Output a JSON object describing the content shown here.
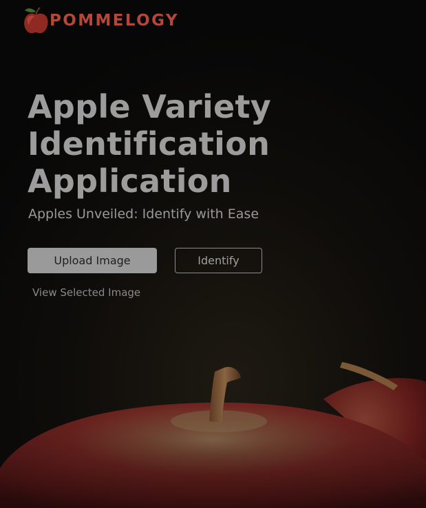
{
  "brand": {
    "logo_icon": "apple-logo-icon",
    "name": "POMMELOGY"
  },
  "hero": {
    "title_lines": [
      "Apple Variety",
      "Identification",
      "Application"
    ],
    "subtitle": "Apples Unveiled: Identify with Ease"
  },
  "actions": {
    "upload_label": "Upload Image",
    "identify_label": "Identify",
    "view_label": "View Selected Image"
  },
  "colors": {
    "background": "#070707",
    "brand": "#b5473a",
    "title": "#9c9c9c",
    "button_fill": "#9a9a9a",
    "apple_red": "#7a1e1c"
  }
}
